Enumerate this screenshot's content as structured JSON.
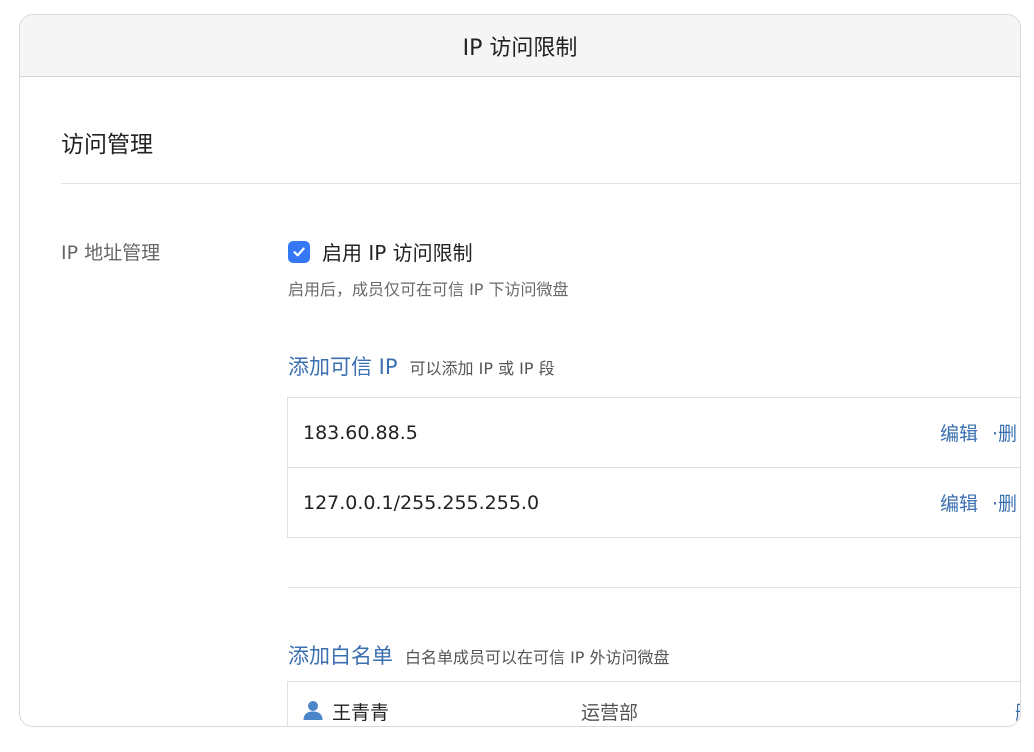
{
  "window": {
    "title": "IP 访问限制"
  },
  "section": {
    "title": "访问管理"
  },
  "ip_management": {
    "label": "IP 地址管理",
    "checkbox_checked": true,
    "checkbox_label": "启用 IP 访问限制",
    "hint": "启用后，成员仅可在可信 IP 下访问微盘"
  },
  "trusted_ip": {
    "add_link": "添加可信 IP",
    "description": "可以添加 IP 或 IP 段",
    "rows": [
      {
        "value": "183.60.88.5",
        "edit": "编辑",
        "delete": "·删"
      },
      {
        "value": "127.0.0.1/255.255.255.0",
        "edit": "编辑",
        "delete": "·删"
      }
    ]
  },
  "whitelist": {
    "add_link": "添加白名单",
    "description": "白名单成员可以在可信 IP 外访问微盘",
    "rows": [
      {
        "icon": "user-icon",
        "name": "王青青",
        "department": "运营部",
        "delete": "删"
      }
    ]
  },
  "colors": {
    "accent": "#3478f6",
    "link": "#3a6fb0"
  }
}
